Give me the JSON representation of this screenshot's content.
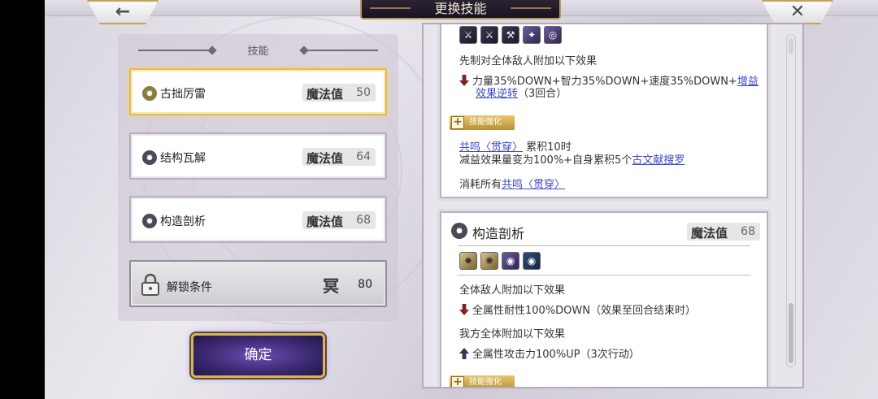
{
  "header": {
    "title": "更换技能",
    "back_icon": "←",
    "close_icon": "✕"
  },
  "left_panel": {
    "heading": "技能",
    "skills": [
      {
        "name": "古拙厉雷",
        "mp_label": "魔法值",
        "mp": "50",
        "selected": true
      },
      {
        "name": "结构瓦解",
        "mp_label": "魔法值",
        "mp": "64",
        "selected": false
      },
      {
        "name": "构造剖析",
        "mp_label": "魔法值",
        "mp": "68",
        "selected": false
      }
    ],
    "locked": {
      "name": "解锁条件",
      "glyph": "冥",
      "value": "80"
    }
  },
  "confirm_label": "确定",
  "detail_card_1": {
    "line1": "先制对全体敌人附加以下效果",
    "effect_a": "力量35%DOWN+智力35%DOWN+速度35%DOWN+",
    "effect_a_link": "增益",
    "effect_a_link2": "效果逆转",
    "effect_a_tail": "（3回合）",
    "enhance_label": "技能强化",
    "resonance_link": "共鸣〈贯穿〉",
    "resonance_tail": "累积10时",
    "line_debuff": "减益效果量变为100%+自身累积5个",
    "debuff_link": "古文献搜罗",
    "consume_prefix": "消耗所有",
    "consume_link": "共鸣〈贯穿〉"
  },
  "detail_card_2": {
    "title": "构造剖析",
    "mp_label": "魔法值",
    "mp": "68",
    "line1": "全体敌人附加以下效果",
    "effect1": "全属性耐性100%DOWN（效果至回合结束时）",
    "line2": "我方全体附加以下效果",
    "effect2": "全属性攻击力100%UP（3次行动）",
    "enhance_label": "技能强化"
  },
  "colors": {
    "gold": "#e4bb4d",
    "link": "#3f47c7",
    "down": "#7a2424",
    "up": "#2b3a55"
  }
}
